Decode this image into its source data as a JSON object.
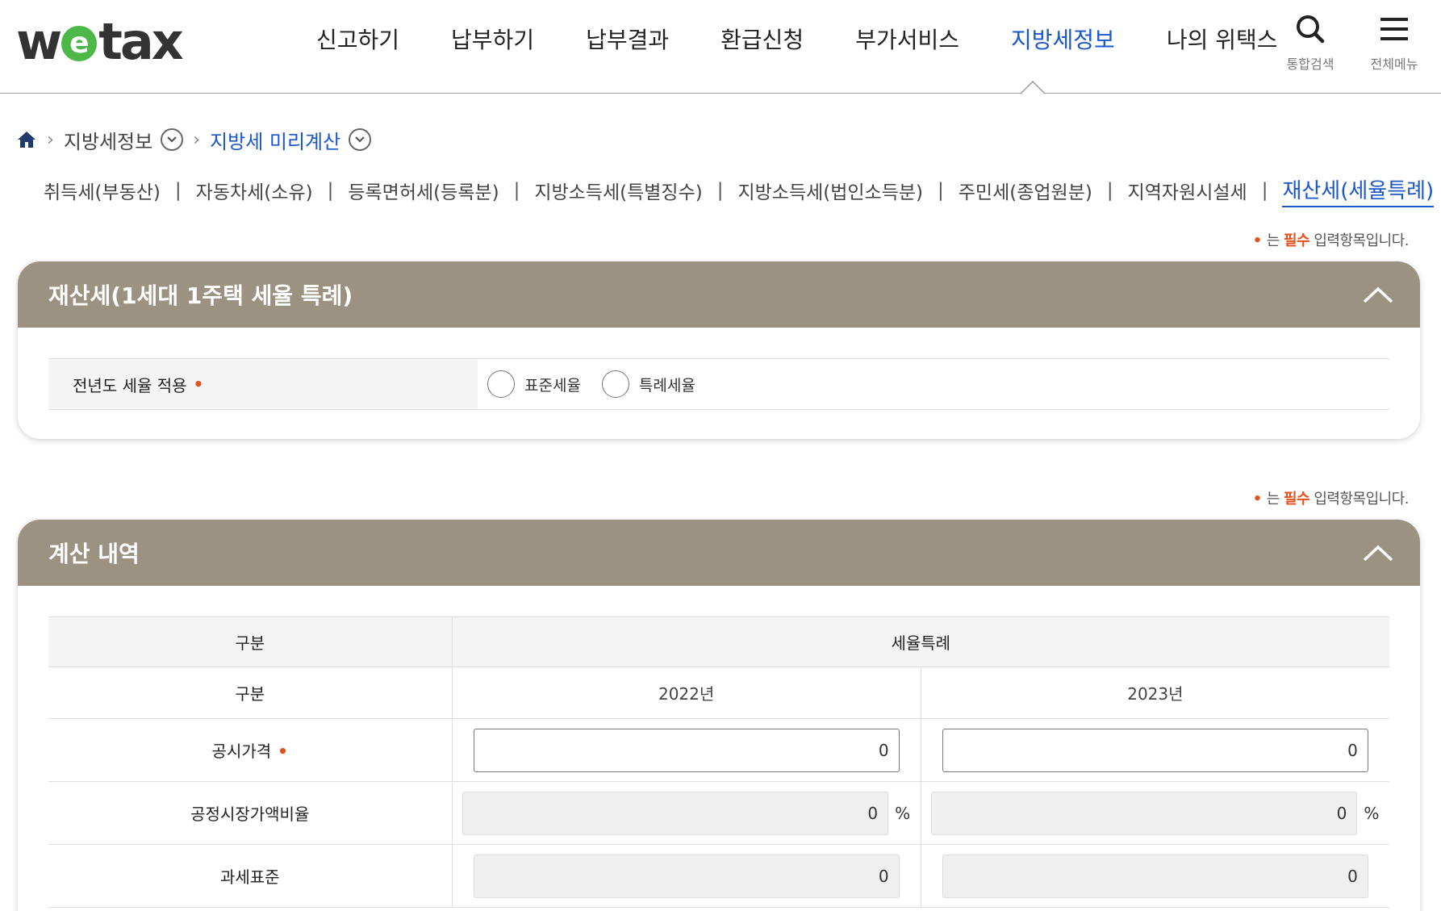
{
  "logo": {
    "part1": "w",
    "part2": "e",
    "part3": "tax"
  },
  "nav": {
    "items": [
      "신고하기",
      "납부하기",
      "납부결과",
      "환급신청",
      "부가서비스",
      "지방세정보",
      "나의 위택스"
    ],
    "active_index": 5,
    "search_label": "통합검색",
    "menu_label": "전체메뉴"
  },
  "breadcrumb": {
    "level1": "지방세정보",
    "level2": "지방세 미리계산"
  },
  "subtabs": {
    "items": [
      "취득세(부동산)",
      "자동차세(소유)",
      "등록면허세(등록분)",
      "지방소득세(특별징수)",
      "지방소득세(법인소득분)",
      "주민세(종업원분)",
      "지역자원시설세",
      "재산세(세율특례)"
    ],
    "active_index": 7
  },
  "required_note": {
    "dot": "•",
    "prefix": "는 ",
    "highlight": "필수",
    "suffix": " 입력항목입니다."
  },
  "panel1": {
    "title": "재산세(1세대 1주택 세율 특례)",
    "row_label": "전년도 세율 적용",
    "required_mark": "•",
    "options": [
      "표준세율",
      "특례세율"
    ]
  },
  "panel2": {
    "title": "계산 내역",
    "header_col1": "구분",
    "header_col2": "세율특례",
    "year_row_label": "구분",
    "years": [
      "2022년",
      "2023년"
    ],
    "rows": [
      {
        "label": "공시가격",
        "required": "•",
        "values": [
          "0",
          "0"
        ],
        "unit": ""
      },
      {
        "label": "공정시장가액비율",
        "required": "",
        "values": [
          "0",
          "0"
        ],
        "unit": "%"
      },
      {
        "label": "과세표준",
        "required": "",
        "values": [
          "0",
          "0"
        ],
        "unit": ""
      }
    ]
  },
  "colors": {
    "accent": "#1a57c9",
    "panel_header": "#9c9282",
    "required": "#e0531f",
    "logo_green": "#4cb848"
  }
}
